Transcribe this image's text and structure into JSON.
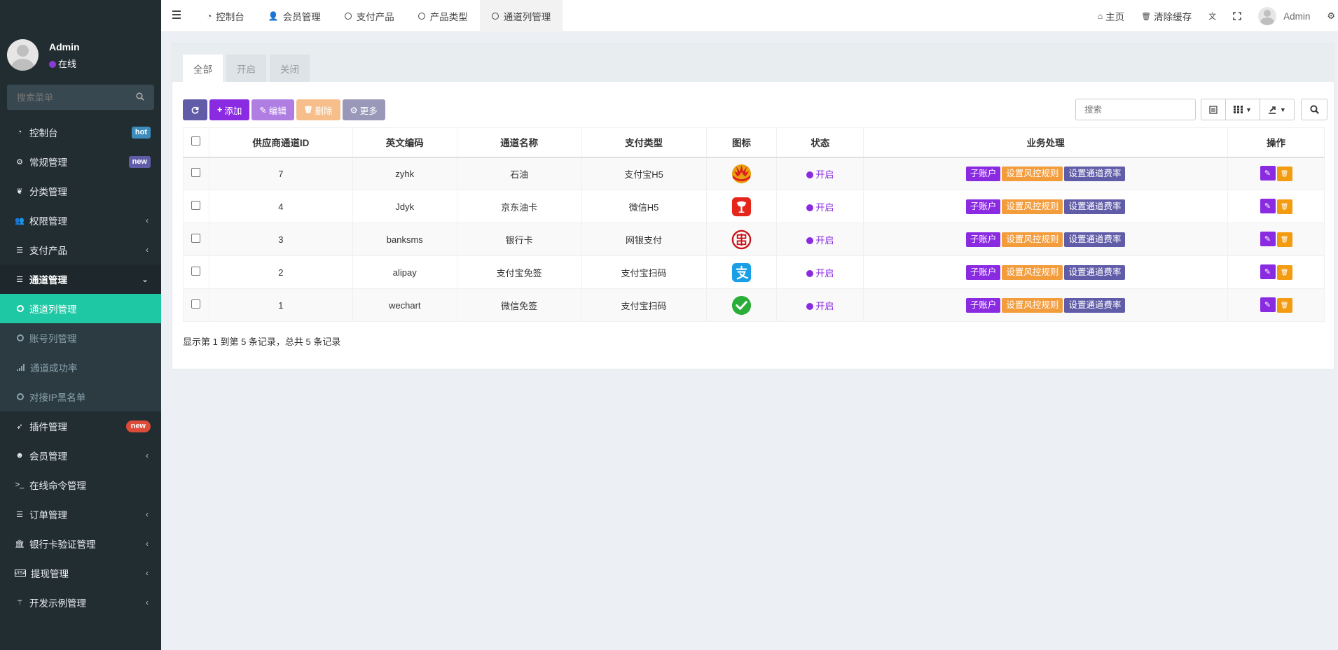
{
  "sidebar": {
    "user": {
      "name": "Admin",
      "status": "在线"
    },
    "search_placeholder": "搜索菜单",
    "items": [
      {
        "label": "控制台",
        "icon": "dashboard-icon",
        "badge": "hot"
      },
      {
        "label": "常规管理",
        "icon": "cogs-icon",
        "badge": "new"
      },
      {
        "label": "分类管理",
        "icon": "leaf-icon"
      },
      {
        "label": "权限管理",
        "icon": "users-icon"
      },
      {
        "label": "支付产品",
        "icon": "list-icon"
      },
      {
        "label": "通道管理",
        "icon": "list-icon"
      },
      {
        "label": "插件管理",
        "icon": "rocket-icon",
        "badge": "new"
      },
      {
        "label": "会员管理",
        "icon": "user-circle-icon"
      },
      {
        "label": "在线命令管理",
        "icon": "terminal-icon"
      },
      {
        "label": "订单管理",
        "icon": "list-icon"
      },
      {
        "label": "银行卡验证管理",
        "icon": "bank-icon"
      },
      {
        "label": "提现管理",
        "icon": "visa-icon"
      },
      {
        "label": "开发示例管理",
        "icon": "magic-icon"
      }
    ],
    "submenu": [
      {
        "label": "通道列管理",
        "active": true
      },
      {
        "label": "账号列管理"
      },
      {
        "label": "通道成功率"
      },
      {
        "label": "对接IP黑名单"
      }
    ]
  },
  "topbar": {
    "tabs": [
      {
        "label": "控制台",
        "icon": "dashboard-icon"
      },
      {
        "label": "会员管理",
        "icon": "user-icon"
      },
      {
        "label": "支付产品",
        "icon": "circle-icon"
      },
      {
        "label": "产品类型",
        "icon": "circle-icon"
      },
      {
        "label": "通道列管理",
        "icon": "circle-icon",
        "active": true
      }
    ],
    "home": "主页",
    "clear_cache": "清除缓存",
    "user_name": "Admin"
  },
  "panel": {
    "tabs": [
      "全部",
      "开启",
      "关闭"
    ],
    "toolbar": {
      "add": "添加",
      "edit": "编辑",
      "delete": "删除",
      "more": "更多"
    },
    "search_placeholder": "搜索",
    "columns": [
      "供应商通道ID",
      "英文编码",
      "通道名称",
      "支付类型",
      "图标",
      "状态",
      "业务处理",
      "操作"
    ],
    "rows": [
      {
        "id": "7",
        "code": "zyhk",
        "name": "石油",
        "type": "支付宝H5",
        "icon": "petrochina-icon",
        "status": "开启"
      },
      {
        "id": "4",
        "code": "Jdyk",
        "name": "京东油卡",
        "type": "微信H5",
        "icon": "jd-icon",
        "status": "开启"
      },
      {
        "id": "3",
        "code": "banksms",
        "name": "银行卡",
        "type": "网银支付",
        "icon": "unionpay-icon",
        "status": "开启"
      },
      {
        "id": "2",
        "code": "alipay",
        "name": "支付宝免签",
        "type": "支付宝扫码",
        "icon": "alipay-icon",
        "status": "开启"
      },
      {
        "id": "1",
        "code": "wechart",
        "name": "微信免签",
        "type": "支付宝扫码",
        "icon": "wechat-icon",
        "status": "开启"
      }
    ],
    "biz_buttons": {
      "sub": "子账户",
      "risk": "设置风控规则",
      "fee": "设置通道费率"
    },
    "footer": "显示第 1 到第 5 条记录，总共 5 条记录"
  },
  "colors": {
    "sidebar_bg": "#222d32",
    "active_green": "#1ec8a5",
    "purple": "#8a2be2",
    "orange": "#f39c12"
  }
}
